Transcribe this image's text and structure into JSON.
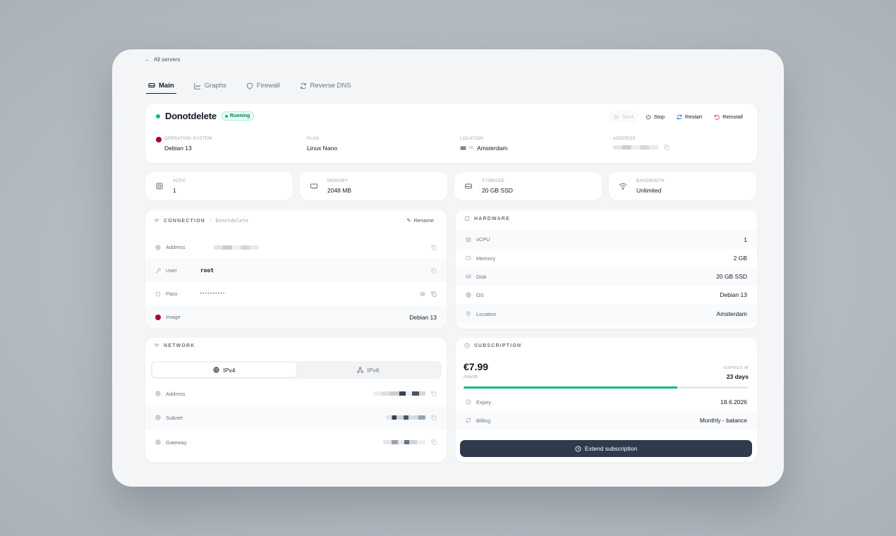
{
  "nav": {
    "back_label": "All servers"
  },
  "tabs": [
    {
      "label": "Main",
      "icon": "server-icon"
    },
    {
      "label": "Graphs",
      "icon": "chart-icon"
    },
    {
      "label": "Firewall",
      "icon": "shield-icon"
    },
    {
      "label": "Reverse DNS",
      "icon": "refresh-icon"
    }
  ],
  "server": {
    "name": "Donotdelete",
    "status": "Running",
    "actions": {
      "start": "Start",
      "stop": "Stop",
      "restart": "Restart",
      "reinstall": "Reinstall"
    },
    "os_label": "OPERATING SYSTEM",
    "os": "Debian 13",
    "plan_label": "PLAN",
    "plan": "Linux Nano",
    "location_label": "LOCATION",
    "country_code": "NL",
    "location": "Amsterdam",
    "address_label": "ADDRESS"
  },
  "stats": [
    {
      "label": "VCPU",
      "value": "1",
      "icon": "cpu-icon"
    },
    {
      "label": "MEMORY",
      "value": "2048 MB",
      "icon": "memory-icon"
    },
    {
      "label": "STORAGE",
      "value": "20 GB SSD",
      "icon": "disk-icon"
    },
    {
      "label": "BANDWIDTH",
      "value": "Unlimited",
      "icon": "wifi-icon"
    }
  ],
  "connection": {
    "title": "CONNECTION",
    "subtitle": "· Donotdelete",
    "rename_label": "Rename",
    "rows": {
      "address": "Address",
      "user": "User",
      "user_value": "root",
      "pass": "Pass",
      "pass_mask": "••••••••••",
      "image": "Image",
      "image_value": "Debian 13"
    }
  },
  "hardware": {
    "title": "HARDWARE",
    "rows": [
      {
        "label": "vCPU",
        "value": "1"
      },
      {
        "label": "Memory",
        "value": "2 GB"
      },
      {
        "label": "Disk",
        "value": "20 GB SSD"
      },
      {
        "label": "OS",
        "value": "Debian 13"
      },
      {
        "label": "Location",
        "value": "Amsterdam"
      }
    ]
  },
  "network": {
    "title": "NETWORK",
    "tab_ipv4": "IPv4",
    "tab_ipv6": "IPv6",
    "rows": {
      "address": "Address",
      "subnet": "Subnet",
      "gateway": "Gateway"
    }
  },
  "subscription": {
    "title": "SUBSCRIPTION",
    "price": "€7.99",
    "period": "/month",
    "expires_label": "EXPIRES IN",
    "expires_value": "23 days",
    "progress": 0.75,
    "expiry_label": "Expiry",
    "expiry_value": "18.6.2026",
    "billing_label": "Billing",
    "billing_value": "Monthly - balance",
    "extend_label": "Extend subscription"
  },
  "colors": {
    "accent_green": "#10b981",
    "button_dark": "#2f3b4d",
    "danger": "#dc2626",
    "info": "#2563eb"
  }
}
